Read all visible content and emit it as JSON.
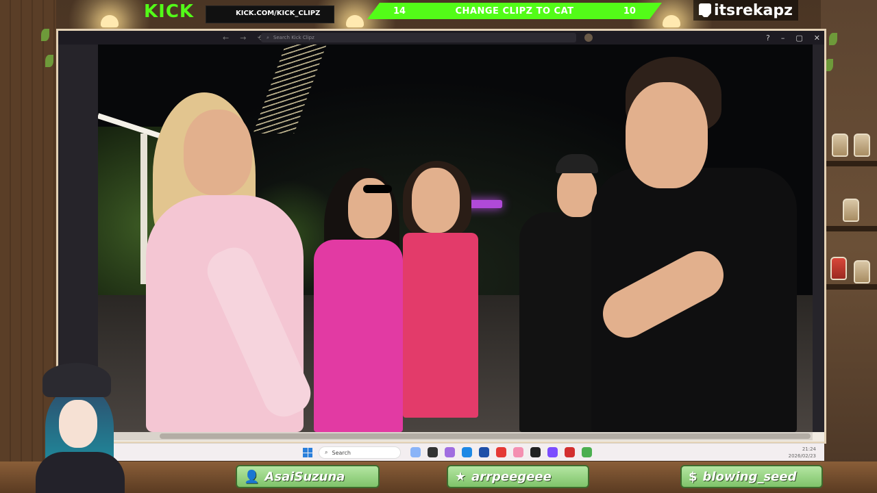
{
  "overlay": {
    "brand": "KICK",
    "kick_url": "KICK.COM/KICK_CLIPZ",
    "vote": {
      "left_count": "14",
      "label": "CHANGE CLIPZ TO CAT",
      "right_count": "10"
    },
    "twitch_handle": "itsrekapz"
  },
  "browser": {
    "search_placeholder": "Search Kick Clipz",
    "back_glyph": "←",
    "forward_glyph": "→",
    "reload_glyph": "⟲",
    "help_glyph": "?",
    "minimize_glyph": "–",
    "maximize_glyph": "▢",
    "close_glyph": "✕"
  },
  "taskbar": {
    "search_label": "Search",
    "time": "21:24",
    "date": "2026/02/23",
    "icon_colors": [
      "#8ab4f8",
      "#333333",
      "#a06de0",
      "#1e88e5",
      "#1f4fa8",
      "#e53935",
      "#f48fb1",
      "#212121",
      "#7c4dff",
      "#d32f2f",
      "#4caf50"
    ]
  },
  "chat_tags": [
    {
      "icon": "person-icon",
      "glyph": "👤",
      "name": "AsaiSuzuna"
    },
    {
      "icon": "star-icon",
      "glyph": "★",
      "name": "arrpeegeee"
    },
    {
      "icon": "dollar-icon",
      "glyph": "$",
      "name": "blowing_seed"
    }
  ],
  "colors": {
    "kick_green": "#53fc18",
    "frame": "#e4d2b6",
    "tag_green": "#7fc36a"
  }
}
